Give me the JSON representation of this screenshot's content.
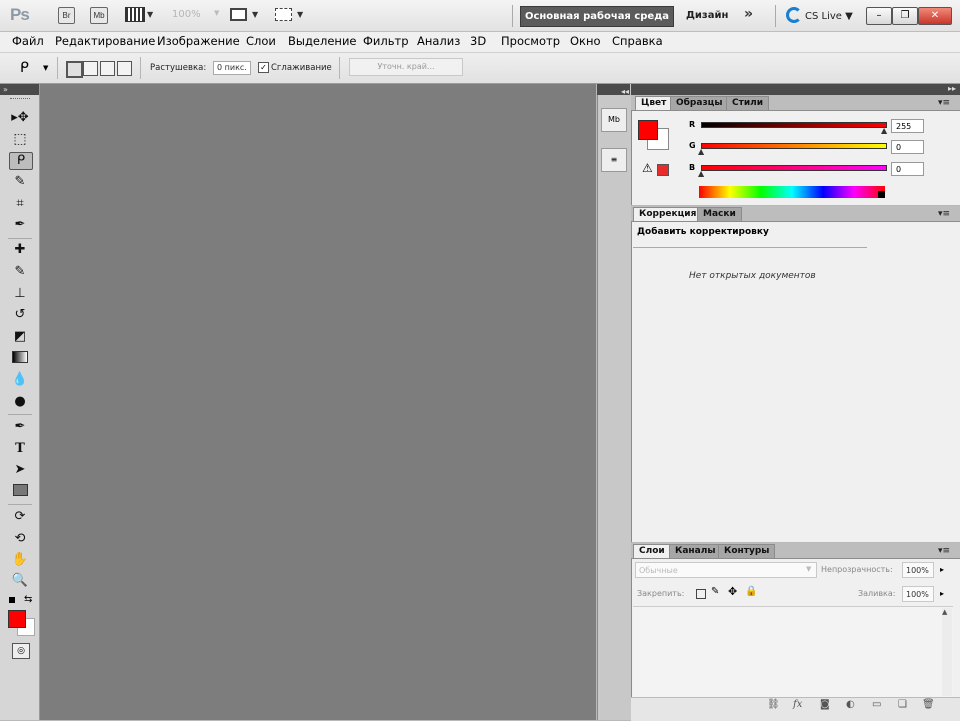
{
  "appbar": {
    "logo": "Ps",
    "bridge_label": "Br",
    "minibridge_label": "Mb",
    "zoom_value": "100%",
    "workspace_button": "Основная рабочая среда",
    "design_label": "Дизайн",
    "overflow_label": "»",
    "cslive_label": "CS Live",
    "minimize_glyph": "–",
    "restore_glyph": "❐",
    "close_glyph": "✕"
  },
  "menu": [
    "Файл",
    "Редактирование",
    "Изображение",
    "Слои",
    "Выделение",
    "Фильтр",
    "Анализ",
    "3D",
    "Просмотр",
    "Окно",
    "Справка"
  ],
  "options": {
    "feather_label": "Растушевка:",
    "feather_value": "0 пикс.",
    "antialias_label": "Сглаживание",
    "antialias_checked": true,
    "refine_edge": "Уточн. край..."
  },
  "toolbox": {
    "collapse": "»",
    "tools": [
      "move-tool",
      "marquee-tool",
      "lasso-tool",
      "quick-selection-tool",
      "crop-tool",
      "eyedropper-tool",
      "healing-brush-tool",
      "brush-tool",
      "clone-stamp-tool",
      "history-brush-tool",
      "eraser-tool",
      "gradient-tool",
      "blur-tool",
      "dodge-tool",
      "pen-tool",
      "type-tool",
      "path-selection-tool",
      "shape-tool",
      "3d-rotate-tool",
      "3d-orbit-tool",
      "hand-tool",
      "zoom-tool"
    ],
    "foreground_color": "#ff0000",
    "background_color": "#ffffff"
  },
  "dock": {
    "minibridge_label": "Mb",
    "history_label": "≡"
  },
  "color_panel": {
    "tabs": [
      "Цвет",
      "Образцы",
      "Стили"
    ],
    "channels": [
      {
        "label": "R",
        "value": "255"
      },
      {
        "label": "G",
        "value": "0"
      },
      {
        "label": "B",
        "value": "0"
      }
    ],
    "foreground": "#ff0000"
  },
  "adjustments_panel": {
    "tabs": [
      "Коррекция",
      "Маски"
    ],
    "add_label": "Добавить корректировку",
    "empty_label": "Нет открытых документов"
  },
  "layers_panel": {
    "tabs": [
      "Слои",
      "Каналы",
      "Контуры"
    ],
    "blend_mode": "Обычные",
    "opacity_label": "Непрозрачность:",
    "opacity_value": "100%",
    "lock_label": "Закрепить:",
    "fill_label": "Заливка:",
    "fill_value": "100%"
  }
}
